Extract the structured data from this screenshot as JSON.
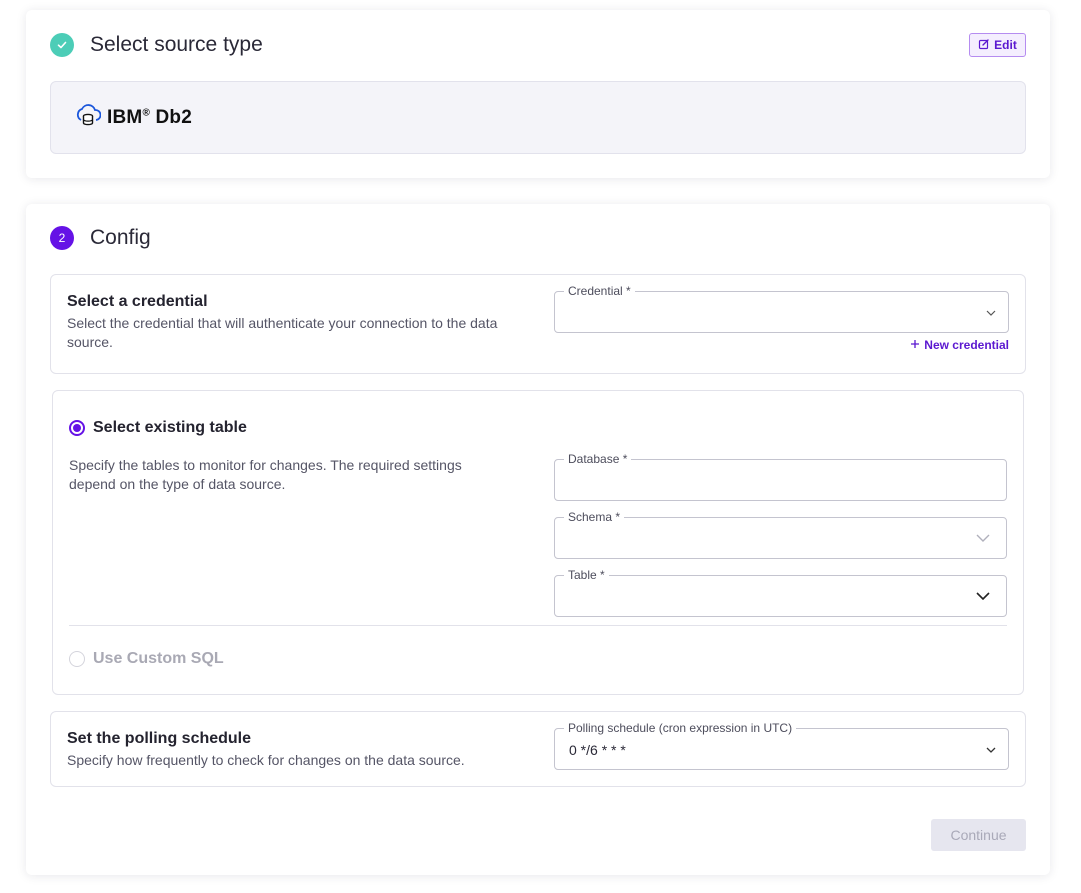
{
  "step1": {
    "title": "Select source type",
    "edit_label": "Edit",
    "source_name": "IBM",
    "source_reg": "®",
    "source_suffix": " Db2"
  },
  "step2": {
    "number": "2",
    "title": "Config",
    "credential": {
      "title": "Select a credential",
      "description": "Select the credential that will authenticate your connection to the data source.",
      "field_label": "Credential *",
      "field_value": "",
      "new_label": "New credential"
    },
    "table": {
      "option_existing": "Select existing table",
      "description": "Specify the tables to monitor for changes. The required settings depend on the type of data source.",
      "database_label": "Database *",
      "database_value": "",
      "schema_label": "Schema *",
      "schema_value": "",
      "table_label": "Table *",
      "table_value": "",
      "option_custom": "Use Custom SQL"
    },
    "polling": {
      "title": "Set the polling schedule",
      "description": "Specify how frequently to check for changes on the data source.",
      "field_label": "Polling schedule (cron expression in UTC)",
      "field_value": "0 */6 * * *"
    },
    "continue_label": "Continue"
  },
  "colors": {
    "accent": "#6512e6",
    "done": "#4ccdb7"
  }
}
